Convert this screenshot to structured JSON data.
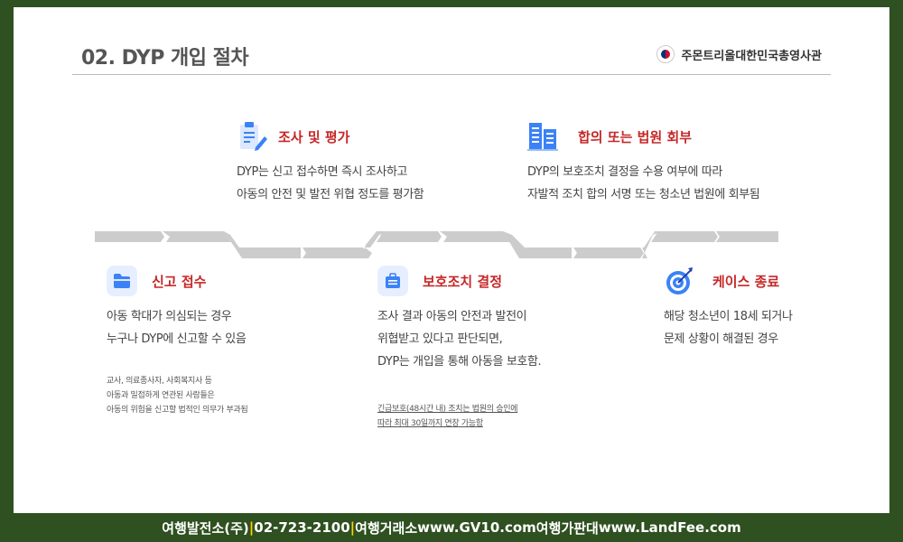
{
  "header": {
    "title": "02. DYP 개입 절차",
    "consulate": "주몬트리올대한민국총영사관"
  },
  "steps": {
    "report": {
      "title": "신고 접수",
      "desc": [
        "아동 학대가 의심되는 경우",
        "누구나 DYP에 신고할 수 있음"
      ],
      "note": [
        "교사, 의료종사자, 사회복지사 등",
        "아동과 밀접하게 연관된 사람들은",
        "아동의 위험을 신고할 법적인 의무가 부과됨"
      ]
    },
    "investigation": {
      "title": "조사 및 평가",
      "desc": [
        "DYP는 신고 접수하면 즉시 조사하고",
        "아동의 안전 및 발전 위협 정도를 평가함"
      ]
    },
    "protection": {
      "title": "보호조치 결정",
      "desc": [
        "조사 결과 아동의 안전과 발전이",
        "위협받고 있다고 판단되면,",
        "DYP는 개입을 통해 아동을 보호함."
      ],
      "note": [
        "긴급보호(48시간 내) 조치는 법원의 승인에",
        "따라 최대 30일까지 연장 가능함"
      ]
    },
    "agreement": {
      "title": "합의 또는 법원 회부",
      "desc": [
        "DYP의 보호조치 결정을 수용 여부에 따라",
        "자발적 조치 합의  서명 또는 청소년 법원에 회부됨"
      ]
    },
    "closure": {
      "title": "케이스 종료",
      "desc": [
        "해당 청소년이 18세 되거나",
        "문제 상황이 해결된 경우"
      ]
    }
  },
  "icons": {
    "report": "folder-icon",
    "investigation": "clipboard-pencil-icon",
    "protection": "briefcase-icon",
    "agreement": "building-icon",
    "closure": "target-icon"
  },
  "colors": {
    "accent": "#c62828",
    "background": "#2f5020",
    "timeline": "#cccccc",
    "icon": "#3b82f6",
    "footer_separator": "#ffd200"
  },
  "footer": {
    "company": "여행발전소(주)",
    "sep1": "|",
    "phone": "02-723-2100",
    "sep2": "|",
    "exchange_label": "여행거래소",
    "exchange_url": "www.GV10.com",
    "market_label": "여행가판대",
    "market_url": "www.LandFee.com"
  }
}
